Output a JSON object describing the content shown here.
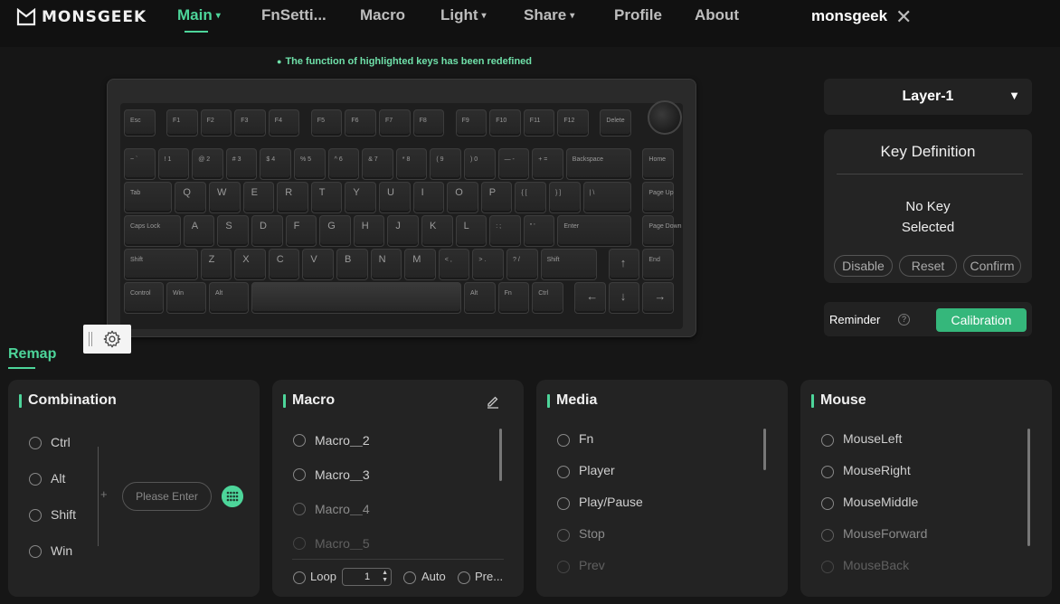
{
  "brand": {
    "name": "MONSGEEK"
  },
  "nav": {
    "items": [
      {
        "label": "Main",
        "caret": "▾"
      },
      {
        "label": "FnSetti...",
        "caret": ""
      },
      {
        "label": "Macro",
        "caret": ""
      },
      {
        "label": "Light",
        "caret": "▾"
      },
      {
        "label": "Share",
        "caret": "▾"
      },
      {
        "label": "Profile",
        "caret": ""
      },
      {
        "label": "About",
        "caret": ""
      }
    ],
    "active": "Main"
  },
  "user": {
    "name": "monsgeek",
    "close_glyph": "✕"
  },
  "notice": {
    "text": "The function of highlighted keys has been redefined"
  },
  "keyboard": {
    "keys": {
      "esc": "Esc",
      "f1": "F1",
      "f2": "F2",
      "f3": "F3",
      "f4": "F4",
      "f5": "F5",
      "f6": "F6",
      "f7": "F7",
      "f8": "F8",
      "f9": "F9",
      "f10": "F10",
      "f11": "F11",
      "f12": "F12",
      "delete": "Delete",
      "grave": "~ `",
      "n1": "! 1",
      "n2": "@ 2",
      "n3": "# 3",
      "n4": "$ 4",
      "n5": "% 5",
      "n6": "^ 6",
      "n7": "& 7",
      "n8": "* 8",
      "n9": "( 9",
      "n0": ") 0",
      "minus": "— -",
      "equal": "+ =",
      "backspace": "Backspace",
      "home": "Home",
      "tab": "Tab",
      "q": "Q",
      "w": "W",
      "e": "E",
      "r": "R",
      "t": "T",
      "y": "Y",
      "u": "U",
      "i": "I",
      "o": "O",
      "p": "P",
      "lbracket": "{ [",
      "rbracket": "} ]",
      "backslash": "| \\",
      "pageup": "Page Up",
      "capslock": "Caps Lock",
      "a": "A",
      "s": "S",
      "d": "D",
      "f": "F",
      "g": "G",
      "h": "H",
      "j": "J",
      "k": "K",
      "l": "L",
      "semicolon": ": ;",
      "quote": "\" '",
      "enter": "Enter",
      "pagedown": "Page Down",
      "lshift": "Shift",
      "z": "Z",
      "x": "X",
      "c": "C",
      "v": "V",
      "b": "B",
      "n": "N",
      "m": "M",
      "comma": "< ,",
      "period": "> .",
      "slash": "? /",
      "rshift": "Shift",
      "up": "↑",
      "end": "End",
      "lctrl": "Control",
      "win": "Win",
      "lalt": "Alt",
      "space": "",
      "ralt": "Alt",
      "fn": "Fn",
      "rctrl": "Ctrl",
      "left": "←",
      "down": "↓",
      "right": "→"
    }
  },
  "layer": {
    "label": "Layer-1",
    "caret": "▼"
  },
  "key_definition": {
    "title": "Key Definition",
    "message_line1": "No Key",
    "message_line2": "Selected",
    "buttons": {
      "disable": "Disable",
      "reset": "Reset",
      "confirm": "Confirm"
    }
  },
  "reminder": {
    "label": "Reminder",
    "help": "?",
    "calibration": "Calibration"
  },
  "remap_tab": "Remap",
  "combination": {
    "title": "Combination",
    "options": [
      "Ctrl",
      "Alt",
      "Shift",
      "Win"
    ],
    "plus": "+",
    "input_placeholder": "Please Enter"
  },
  "macro": {
    "title": "Macro",
    "items": [
      "Macro＿2",
      "Macro＿3",
      "Macro＿4",
      "Macro＿5"
    ],
    "loop_label": "Loop",
    "loop_value": "1",
    "auto_label": "Auto",
    "press_label": "Pre..."
  },
  "media": {
    "title": "Media",
    "items": [
      "Fn",
      "Player",
      "Play/Pause",
      "Stop",
      "Prev"
    ]
  },
  "mouse": {
    "title": "Mouse",
    "items": [
      "MouseLeft",
      "MouseRight",
      "MouseMiddle",
      "MouseForward",
      "MouseBack"
    ]
  },
  "colors": {
    "accent": "#4dd59a",
    "button_green": "#35b77b",
    "background": "#161616",
    "panel": "#232323"
  }
}
